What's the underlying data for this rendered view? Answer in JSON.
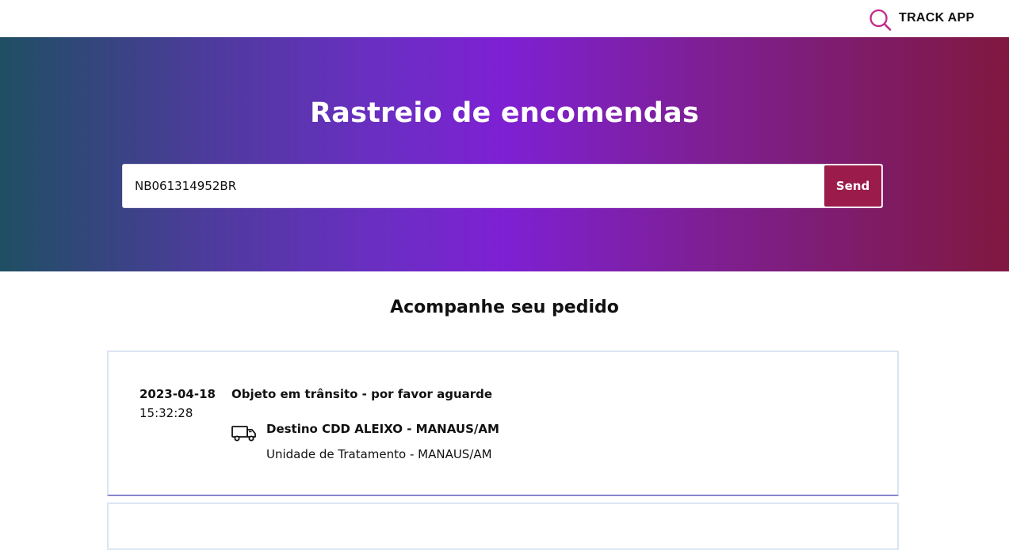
{
  "header": {
    "brand_label": "TRACK APP",
    "brand_icon": "search-icon",
    "accent_color": "#c2298a"
  },
  "hero": {
    "title": "Rastreio de encomendas",
    "search_value": "NB061314952BR",
    "send_label": "Send",
    "send_color": "#9b1c4a"
  },
  "tracking": {
    "section_title": "Acompanhe seu pedido",
    "events": [
      {
        "date": "2023-04-18",
        "time": "15:32:28",
        "status": "Objeto em trânsito - por favor aguarde",
        "icon": "truck-icon",
        "destination": "Destino CDD ALEIXO - MANAUS/AM",
        "unit": "Unidade de Tratamento - MANAUS/AM"
      }
    ]
  }
}
